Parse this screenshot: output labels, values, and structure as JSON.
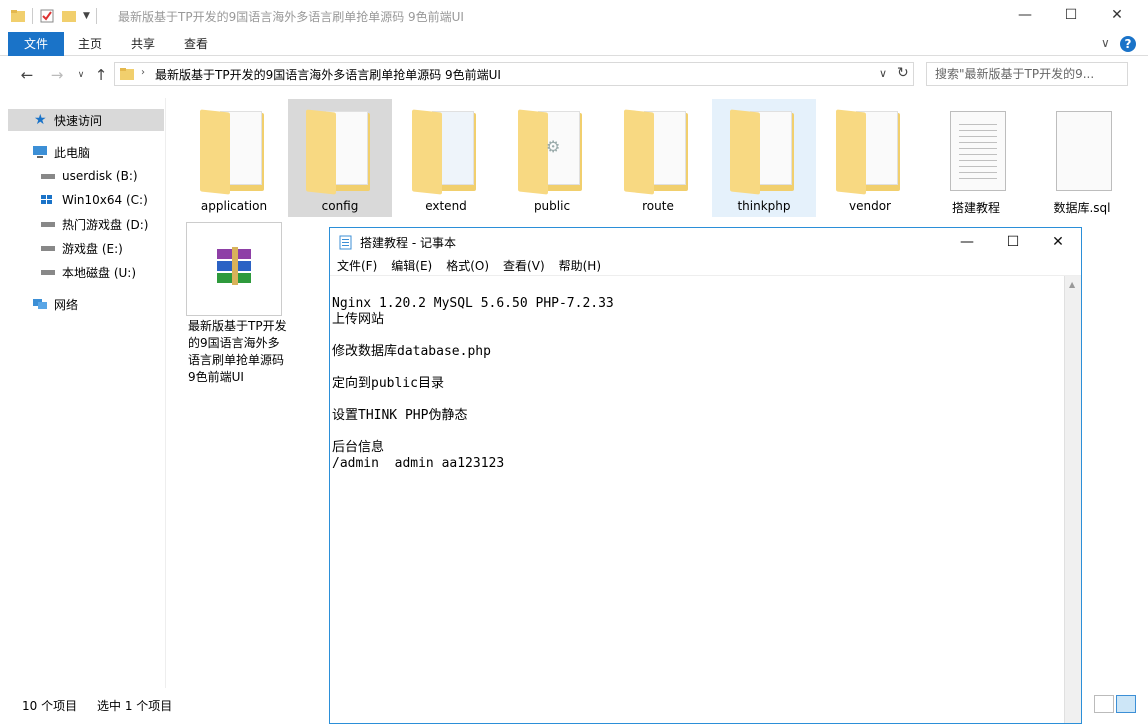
{
  "window": {
    "title": "最新版基于TP开发的9国语言海外多语言刷单抢单源码 9色前端UI",
    "min": "—",
    "max": "☐",
    "close": "✕"
  },
  "ribbon": {
    "file": "文件",
    "home": "主页",
    "share": "共享",
    "view": "查看",
    "collapse": "∨",
    "help": "?"
  },
  "address": {
    "path": "最新版基于TP开发的9国语言海外多语言刷单抢单源码 9色前端UI",
    "search_placeholder": "搜索\"最新版基于TP开发的9..."
  },
  "nav": {
    "quick_access": "快速访问",
    "this_pc": "此电脑",
    "drives": [
      "userdisk (B:)",
      "Win10x64 (C:)",
      "热门游戏盘 (D:)",
      "游戏盘 (E:)",
      "本地磁盘 (U:)"
    ],
    "network": "网络"
  },
  "files": {
    "items": [
      "application",
      "config",
      "extend",
      "public",
      "route",
      "thinkphp",
      "vendor",
      "搭建教程",
      "数据库.sql"
    ],
    "archive_label": "最新版基于TP开发的9国语言海外多语言刷单抢单源码 9色前端UI"
  },
  "status": {
    "count": "10 个项目",
    "selected": "选中 1 个项目"
  },
  "notepad": {
    "title": "搭建教程 - 记事本",
    "menu": [
      "文件(F)",
      "编辑(E)",
      "格式(O)",
      "查看(V)",
      "帮助(H)"
    ],
    "content": "Nginx 1.20.2 MySQL 5.6.50 PHP-7.2.33\n上传网站\n\n修改数据库database.php\n\n定向到public目录\n\n设置THINK PHP伪静态\n\n后台信息\n/admin  admin aa123123"
  },
  "colors": {
    "accent": "#1a73c8",
    "folder": "#f1cf6d",
    "selection": "#d9d9d9",
    "hover": "#e5f1fb"
  }
}
